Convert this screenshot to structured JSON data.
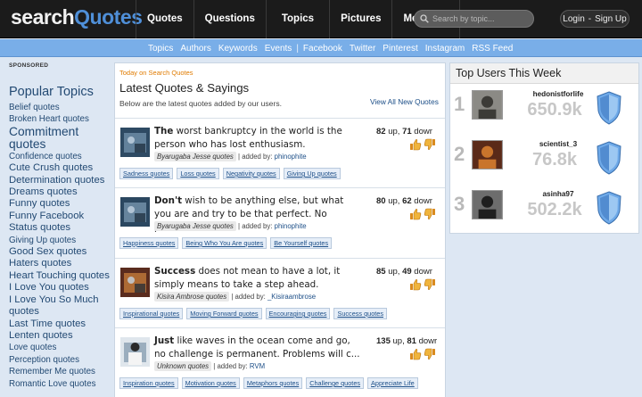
{
  "header": {
    "logo_part1": "search",
    "logo_part2": "Quotes",
    "nav": [
      "Quotes",
      "Questions",
      "Topics",
      "Pictures",
      "Members"
    ],
    "search_placeholder": "Search by topic...",
    "login": "Login",
    "login_sep": "-",
    "signup": "Sign Up"
  },
  "subnav": {
    "items": [
      "Topics",
      "Authors",
      "Keywords",
      "Events",
      "|",
      "Facebook",
      "Twitter",
      "Pinterest",
      "Instagram",
      "RSS Feed"
    ]
  },
  "sidebar": {
    "sponsored": "SPONSORED",
    "title": "Popular Topics",
    "topics": [
      {
        "label": "Belief quotes",
        "size": 1
      },
      {
        "label": "Broken Heart quotes",
        "size": 1
      },
      {
        "label": "Commitment",
        "size": 3
      },
      {
        "label": "quotes",
        "size": 3
      },
      {
        "label": "Confidence quotes",
        "size": 1
      },
      {
        "label": "Cute Crush quotes",
        "size": 2
      },
      {
        "label": "Determination quotes",
        "size": 2
      },
      {
        "label": "Dreams quotes",
        "size": 2
      },
      {
        "label": "Funny quotes",
        "size": 2
      },
      {
        "label": "Funny Facebook",
        "size": 2
      },
      {
        "label": "Status quotes",
        "size": 2
      },
      {
        "label": "Giving Up quotes",
        "size": 1
      },
      {
        "label": "Good Sex quotes",
        "size": 2
      },
      {
        "label": "Haters quotes",
        "size": 2
      },
      {
        "label": "Heart Touching quotes",
        "size": 2
      },
      {
        "label": "I Love You quotes",
        "size": 2
      },
      {
        "label": "I Love You So Much",
        "size": 2
      },
      {
        "label": "quotes",
        "size": 2
      },
      {
        "label": "Last Time quotes",
        "size": 2
      },
      {
        "label": "Lenten quotes",
        "size": 2
      },
      {
        "label": "Love quotes",
        "size": 1
      },
      {
        "label": "Perception quotes",
        "size": 1
      },
      {
        "label": "Remember Me quotes",
        "size": 1
      },
      {
        "label": "Romantic Love quotes",
        "size": 1
      }
    ]
  },
  "main": {
    "today": "Today on Search Quotes",
    "heading": "Latest Quotes & Sayings",
    "subheading": "Below are the latest quotes added by our users.",
    "view_all": "View All New Quotes",
    "quotes": [
      {
        "first_word": "The",
        "rest": " worst bankruptcy in the world is the person who has lost enthusiasm.",
        "author": "Byarugaba Jesse quotes",
        "added_by_label": "| added by:",
        "user": "phinophite",
        "up": "82",
        "up_label": "up,",
        "down": "71",
        "down_label": "dowr",
        "tags": [
          "Sadness quotes",
          "Loss quotes",
          "Negativity quotes",
          "Giving Up quotes"
        ]
      },
      {
        "first_word": "Don't",
        "rest": " wish to be anything else, but what you are and try to be that perfect. No probl...",
        "author": "Byarugaba Jesse quotes",
        "added_by_label": "| added by:",
        "user": "phinophite",
        "up": "80",
        "up_label": "up,",
        "down": "62",
        "down_label": "dowr",
        "tags": [
          "Happiness quotes",
          "Being Who You Are quotes",
          "Be Yourself quotes"
        ]
      },
      {
        "first_word": "Success",
        "rest": " does not mean to have a lot, it simply means to take a step ahead.",
        "author": "Kisira Ambrose quotes",
        "added_by_label": "| added by:",
        "user": "_Kisiraambrose",
        "up": "85",
        "up_label": "up,",
        "down": "49",
        "down_label": "dowr",
        "tags": [
          "Inspirational quotes",
          "Moving Forward quotes",
          "Encouraging quotes",
          "Success quotes"
        ]
      },
      {
        "first_word": "Just",
        "rest": " like waves in the ocean come and go, no challenge is permanent. Problems will c...",
        "author": "Unknown quotes",
        "added_by_label": "| added by:",
        "user": "RVM",
        "up": "135",
        "up_label": "up,",
        "down": "81",
        "down_label": "dowr",
        "tags": [
          "Inspiration quotes",
          "Motivation quotes",
          "Metaphors quotes",
          "Challenge quotes",
          "Appreciate Life"
        ]
      }
    ]
  },
  "top_users": {
    "title": "Top Users This Week",
    "users": [
      {
        "rank": "1",
        "name": "hedonistforlife",
        "score": "650.9k"
      },
      {
        "rank": "2",
        "name": "scientist_3",
        "score": "76.8k"
      },
      {
        "rank": "3",
        "name": "asinha97",
        "score": "502.2k"
      }
    ]
  },
  "colors": {
    "topbar": "#1b1b1b",
    "subbar": "#79aee8",
    "accent_blue": "#4f8fd8",
    "link": "#1d4f88",
    "orange": "#e07b00"
  },
  "icons": {
    "search": "search-icon",
    "thumb_up": "thumb-up-icon",
    "thumb_down": "thumb-down-icon",
    "shield": "shield-badge-icon"
  }
}
